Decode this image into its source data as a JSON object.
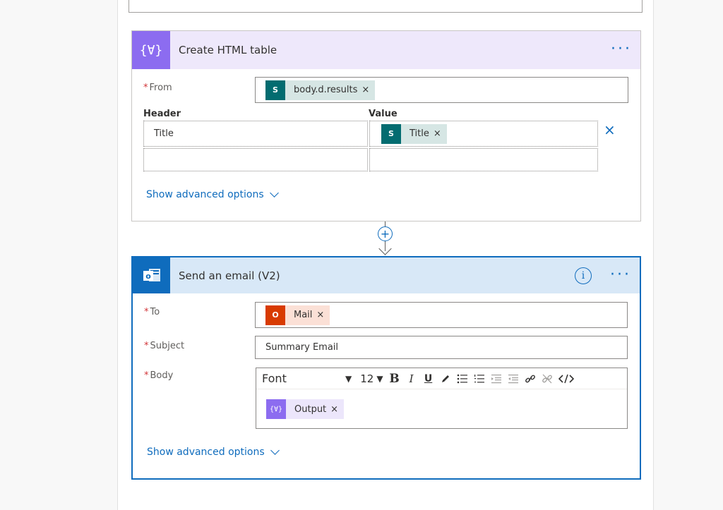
{
  "html_table_card": {
    "title": "Create HTML table",
    "icon": "{∀}",
    "from_label": "From",
    "from_token": {
      "label": "body.d.results",
      "icon": "S"
    },
    "header_col": "Header",
    "value_col": "Value",
    "rows": [
      {
        "header": "Title",
        "value_token": {
          "label": "Title",
          "icon": "S"
        }
      },
      {
        "header": "",
        "value_token": null
      }
    ],
    "advanced_link": "Show advanced options"
  },
  "email_card": {
    "title": "Send an email (V2)",
    "info_glyph": "i",
    "to_label": "To",
    "to_token": {
      "label": "Mail",
      "icon": "O"
    },
    "subject_label": "Subject",
    "subject_value": "Summary Email",
    "body_label": "Body",
    "editor": {
      "font": "Font",
      "size": "12",
      "bold": "B",
      "italic": "I",
      "underline": "U"
    },
    "body_token": {
      "label": "Output",
      "icon": "{∀}"
    },
    "advanced_link": "Show advanced options"
  },
  "common": {
    "required_mark": "*",
    "remove_glyph": "×",
    "more_glyph": "···",
    "add_step_glyph": "+"
  },
  "colors": {
    "accent": "#0f6cbd",
    "data_operation": "#8c6cf0",
    "sharepoint": "#036c70",
    "office": "#d83b01",
    "required": "#d13438"
  }
}
